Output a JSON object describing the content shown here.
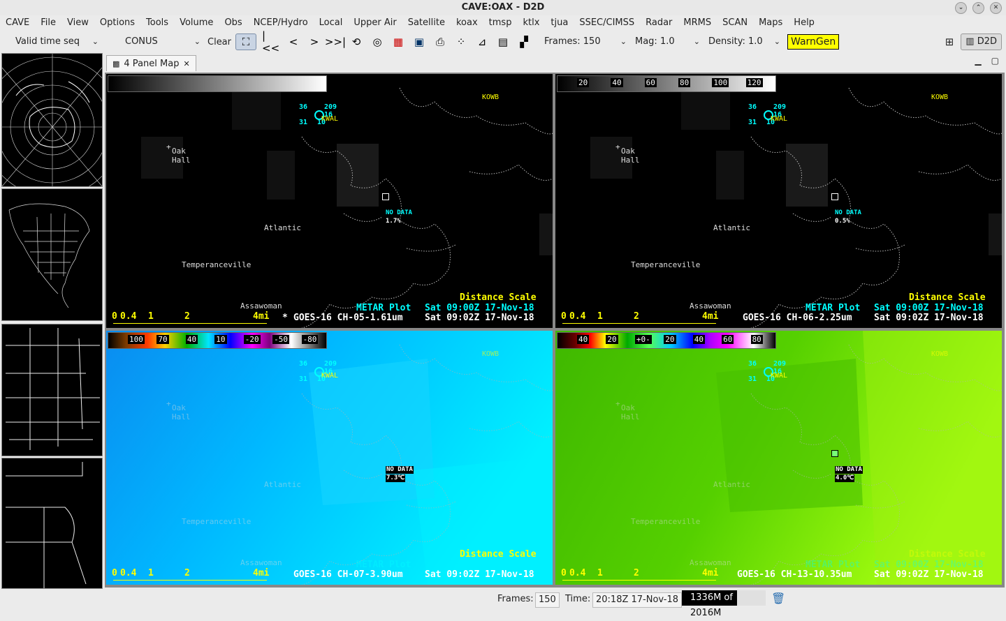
{
  "window": {
    "title": "CAVE:OAX - D2D"
  },
  "menu": [
    "CAVE",
    "File",
    "View",
    "Options",
    "Tools",
    "Volume",
    "Obs",
    "NCEP/Hydro",
    "Local",
    "Upper Air",
    "Satellite",
    "koax",
    "tmsp",
    "ktlx",
    "tjua",
    "SSEC/CIMSS",
    "Radar",
    "MRMS",
    "SCAN",
    "Maps",
    "Help"
  ],
  "toolbar": {
    "time_mode": "Valid time seq",
    "scale": "CONUS",
    "clear_label": "Clear",
    "frames_label": "Frames: 150",
    "mag_label": "Mag: 1.0",
    "density_label": "Density: 1.0",
    "warngen_label": "WarnGen",
    "perspective_label": "D2D"
  },
  "tab": {
    "label": "4 Panel Map"
  },
  "cities": {
    "oak": "Oak",
    "hall": "Hall",
    "atlantic": "Atlantic",
    "temperanceville": "Temperanceville",
    "assawoman": "Assawoman",
    "kow": "KOWB",
    "kwal": "KWAL"
  },
  "metar": {
    "temp": "36",
    "dew": "31",
    "pres": "209",
    "vis": "10",
    "wx": "16"
  },
  "scale_bar": {
    "ticks": [
      "0",
      "0.4",
      "1",
      "2",
      "4mi"
    ],
    "title": "Distance Scale"
  },
  "panels": [
    {
      "product": "GOES-16 CH-05-1.61um",
      "time": "Sat 09:02Z 17-Nov-18",
      "metar_label": "METAR Plot",
      "metar_time": "Sat 09:00Z 17-Nov-18",
      "prefix": "*",
      "nodata": "NO DATA",
      "value": "1.7%",
      "colorbar_labels": []
    },
    {
      "product": "GOES-16 CH-06-2.25um",
      "time": "Sat 09:02Z 17-Nov-18",
      "metar_label": "METAR Plot",
      "metar_time": "Sat 09:00Z 17-Nov-18",
      "prefix": "",
      "nodata": "NO DATA",
      "value": "0.5%",
      "colorbar_labels": [
        "20",
        "40",
        "60",
        "80",
        "100",
        "120"
      ]
    },
    {
      "product": "GOES-16 CH-07-3.90um",
      "time": "Sat 09:02Z 17-Nov-18",
      "metar_label": "METAR Plot",
      "metar_time": "",
      "prefix": "",
      "nodata": "NO DATA",
      "value": "7.3℃",
      "colorbar_labels": [
        "100",
        "70",
        "40",
        "10",
        "-20",
        "-50",
        "-80"
      ]
    },
    {
      "product": "GOES-16 CH-13-10.35um",
      "time": "Sat 09:02Z 17-Nov-18",
      "metar_label": "METAR Plot",
      "metar_time": "Sat 09:00Z 17-Nov-18",
      "prefix": "",
      "nodata": "NO DATA",
      "value": "4.0℃",
      "colorbar_labels": [
        "40",
        "20",
        "+0-",
        "20",
        "40",
        "60",
        "80"
      ]
    }
  ],
  "status": {
    "frames_label": "Frames:",
    "frames_value": "150",
    "time_label": "Time:",
    "time_value": "20:18Z 17-Nov-18",
    "memory": "1336M of 2016M",
    "memory_fraction": 0.66
  },
  "icons": [
    "minimize-icon",
    "maximize-icon",
    "close-icon",
    "zoom-extent-icon",
    "first-frame-icon",
    "prev-frame-icon",
    "next-frame-icon",
    "last-frame-icon",
    "loop-icon",
    "loop-props-icon",
    "image-props-icon",
    "bg-color-icon",
    "print-icon",
    "points-icon",
    "pan-icon",
    "single-panel-icon",
    "four-panel-icon",
    "trash-icon"
  ]
}
